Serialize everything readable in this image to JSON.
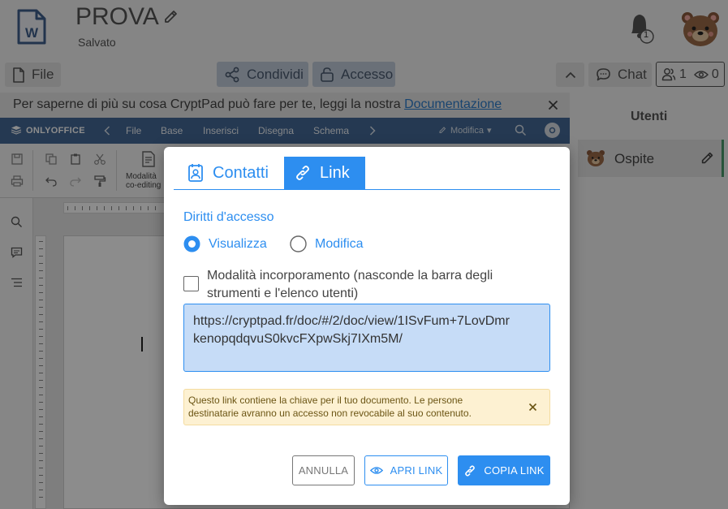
{
  "app": {
    "doc_title": "PROVA",
    "doc_status": "Salvato",
    "notifications_count": "1"
  },
  "toolbar": {
    "file_label": "File",
    "share_label": "Condividi",
    "access_label": "Accesso",
    "chat_label": "Chat",
    "users_count": "1",
    "viewers_count": "0"
  },
  "info_bar": {
    "text": "Per saperne di più su cosa CryptPad può fare per te, leggi la nostra ",
    "link": "Documentazione"
  },
  "onlyoffice": {
    "brand": "ONLYOFFICE",
    "menu": [
      "File",
      "Base",
      "Inserisci",
      "Disegna",
      "Schema"
    ],
    "mode_label": "Modifica",
    "mode_tool_line1": "Modalità",
    "mode_tool_line2": "co-editing"
  },
  "users_panel": {
    "title": "Utenti",
    "user_name": "Ospite"
  },
  "modal": {
    "tabs": {
      "contacts": "Contatti",
      "link": "Link"
    },
    "rights_title": "Diritti d'accesso",
    "radio_view": "Visualizza",
    "radio_edit": "Modifica",
    "embed_line1": "Modalità incorporamento (nasconde la barra degli",
    "embed_line2": "strumenti e l'elenco utenti)",
    "link_line1": "https://cryptpad.fr/doc/#/2/doc/view/1ISvFum+7LovDmr",
    "link_line2": "kenopqdqvuS0kvcFXpwSkj7IXm5M/",
    "warning_line1": "Questo link contiene la chiave per il tuo documento. Le persone",
    "warning_line2": "destinatarie avranno un accesso non revocabile al suo contenuto.",
    "btn_cancel": "ANNULLA",
    "btn_open": "APRI LINK",
    "btn_copy": "COPIA LINK"
  },
  "colors": {
    "accent": "#2d8ef0",
    "link_box_bg": "#c6dcf7",
    "warning_bg": "#fdf1d2",
    "oo_header": "#446995"
  }
}
